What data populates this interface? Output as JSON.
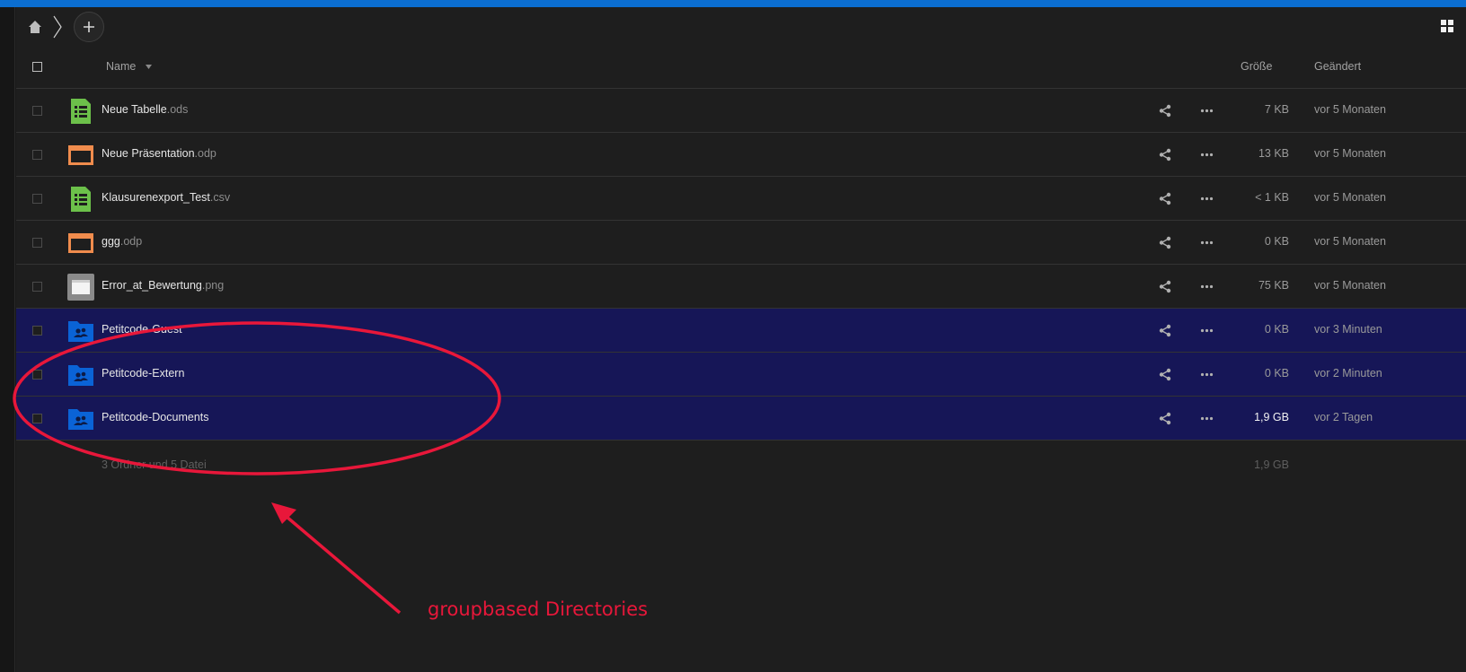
{
  "colors": {
    "accent": "#0b6ed1",
    "background": "#1e1e1e",
    "annotation": "#e8173a",
    "highlight": "#14146e",
    "spreadsheet_icon": "#6cc04a",
    "presentation_icon": "#f08c4d",
    "folder_icon": "#0a63d6"
  },
  "toolbar": {
    "home_icon": "home-icon",
    "add_icon": "plus-icon",
    "view_icon": "grid-view-icon"
  },
  "header": {
    "name": "Name",
    "size": "Größe",
    "modified": "Geändert"
  },
  "files": [
    {
      "base": "Neue Tabelle",
      "ext": ".ods",
      "icon": "spreadsheet-icon",
      "size": "7 KB",
      "modified": "vor 5 Monaten"
    },
    {
      "base": "Neue Präsentation",
      "ext": ".odp",
      "icon": "presentation-icon",
      "size": "13 KB",
      "modified": "vor 5 Monaten"
    },
    {
      "base": "Klausurenexport_Test",
      "ext": ".csv",
      "icon": "spreadsheet-icon",
      "size": "< 1 KB",
      "modified": "vor 5 Monaten"
    },
    {
      "base": "ggg",
      "ext": ".odp",
      "icon": "presentation-icon",
      "size": "0 KB",
      "modified": "vor 5 Monaten"
    },
    {
      "base": "Error_at_Bewertung",
      "ext": ".png",
      "icon": "image-icon",
      "size": "75 KB",
      "modified": "vor 5 Monaten"
    },
    {
      "base": "Petitcode-Guest",
      "ext": "",
      "icon": "group-folder-icon",
      "size": "0 KB",
      "modified": "vor 3 Minuten"
    },
    {
      "base": "Petitcode-Extern",
      "ext": "",
      "icon": "group-folder-icon",
      "size": "0 KB",
      "modified": "vor 2 Minuten"
    },
    {
      "base": "Petitcode-Documents",
      "ext": "",
      "icon": "group-folder-icon",
      "size": "1,9 GB",
      "modified": "vor 2 Tagen"
    }
  ],
  "summary": {
    "text": "3 Ordner und 5 Datei",
    "size": "1,9 GB"
  },
  "annotation": {
    "label": "groupbased Directories"
  }
}
